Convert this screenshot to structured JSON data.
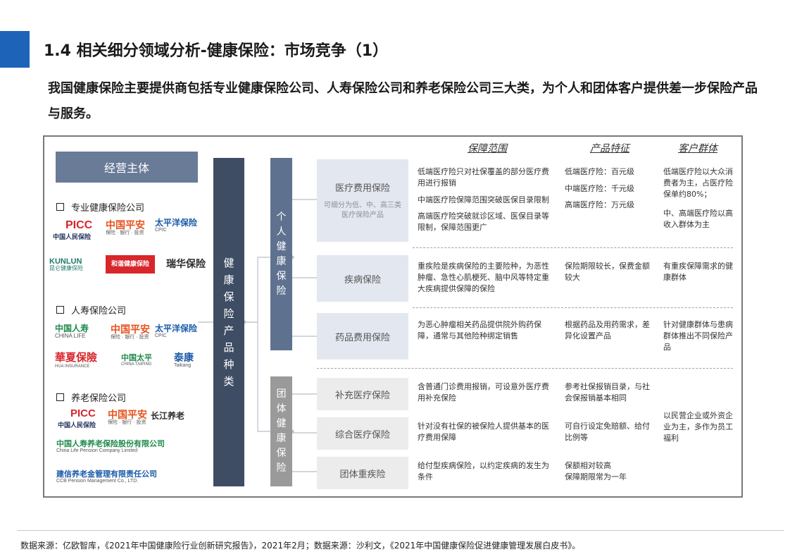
{
  "header": {
    "title": "1.4 相关细分领域分析-健康保险：市场竞争（1）",
    "subtitle": "我国健康保险主要提供商包括专业健康保险公司、人寿保险公司和养老保险公司三大类，为个人和团体客户提供差一步保险产品与服务。"
  },
  "left": {
    "header": "经营主体",
    "categories": [
      "专业健康保险公司",
      "人寿保险公司",
      "养老保险公司"
    ],
    "logos": {
      "picc": "PICC",
      "picc_sub": "中国人民保险",
      "pingan": "中国平安",
      "pingan_sub": "保险 · 银行 · 投资",
      "cpic": "太平洋保险",
      "cpic_sub": "CPIC",
      "kunlun": "KUNLUN",
      "kunlun_sub": "昆仑健康保险",
      "hexie": "和谐健康保险",
      "ruihua": "瑞华保险",
      "chinalife": "中国人寿",
      "chinalife_sub": "CHINA LIFE",
      "huaxia": "華夏保險",
      "huaxia_sub": "HUA INSURANCE",
      "taiping": "中国太平",
      "taiping_sub": "CHINA TAIPING",
      "taikang": "泰康",
      "taikang_sub": "Taikang",
      "changjiang": "长江养老",
      "clpension": "中国人寿养老保险股份有限公司",
      "clpension_sub": "China Life Pension Company Limited",
      "ccb": "建信养老金管理有限责任公司",
      "ccb_sub": "CCB Pension Management Co., LTD."
    }
  },
  "center": {
    "product_type": "健康保险产品种类",
    "personal": "个人健康保险",
    "group": "团体健康保险"
  },
  "columns": {
    "scope": "保障范围",
    "feature": "产品特征",
    "customer": "客户群体"
  },
  "rows": [
    {
      "product": "医疗费用保险",
      "note": "可细分为低、中、高三类医疗保险产品",
      "scope": [
        "低端医疗险只对社保覆盖的部分医疗费用进行报销",
        "中端医疗险保障范围突破医保目录限制",
        "高端医疗险突破就诊区域、医保目录等限制，保障范围更广"
      ],
      "feature": [
        "低端医疗险：百元级",
        "中端医疗险：千元级",
        "高端医疗险：万元级"
      ],
      "customer": [
        "低端医疗险以大众消费者为主，占医疗险保单约80%；",
        "中、高端医疗险以高收入群体为主"
      ]
    },
    {
      "product": "疾病保险",
      "scope": [
        "重疾险是疾病保险的主要险种，为恶性肿瘤、急性心肌梗死、脑中风等特定重大疾病提供保障的保险"
      ],
      "feature": [
        "保险期限较长，保费金额较大"
      ],
      "customer": [
        "有重疾保障需求的健康群体"
      ]
    },
    {
      "product": "药品费用保险",
      "scope": [
        "为恶心肿瘤相关药品提供院外购药保障，通常与其他险种绑定销售"
      ],
      "feature": [
        "根据药品及用药需求，差异化设置产品"
      ],
      "customer": [
        "针对健康群体与患病群体推出不同保险产品"
      ]
    },
    {
      "product": "补充医疗保险",
      "scope": [
        "含普通门诊费用报销，可设意外医疗费用补充保险"
      ],
      "feature": [
        "参考社保报销目录，与社会保报销基本相同"
      ]
    },
    {
      "product": "综合医疗保险",
      "scope": [
        "针对没有社保的被保险人提供基本的医疗费用保障"
      ],
      "feature": [
        "可自行设定免赔额、给付比例等"
      ]
    },
    {
      "product": "团体重疾险",
      "scope": [
        "给付型疾病保险，以约定疾病的发生为条件"
      ],
      "feature": [
        "保额相对较高",
        "保障期限常为一年"
      ]
    }
  ],
  "group_customer": "以民营企业或外资企业为主，多作为员工福利",
  "footer": "数据来源：亿欧智库，《2021年中国健康险行业创新研究报告》，2021年2月；数据来源：沙利文，《2021年中国健康保险促进健康管理发展白皮书》。"
}
